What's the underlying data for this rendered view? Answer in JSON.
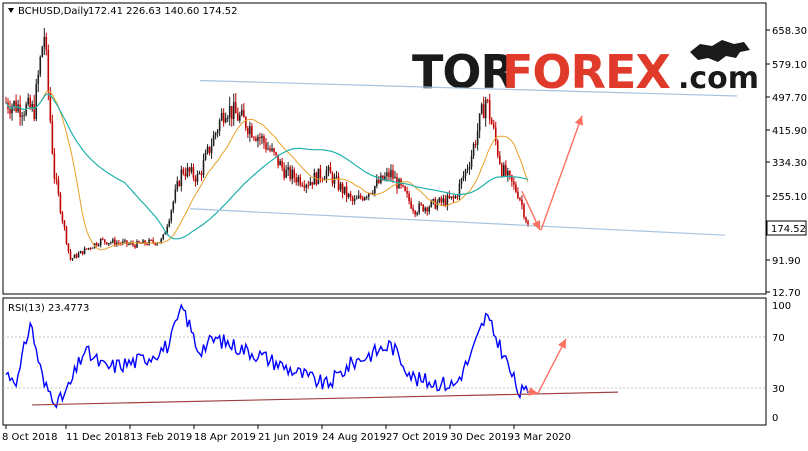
{
  "chart_data": [
    {
      "type": "candlestick",
      "panel": "price",
      "header": {
        "symbol": "BCHUSD,Daily",
        "ohlc": "172.41 226.63 140.60 174.52"
      },
      "y_ticks": [
        "658.30",
        "579.10",
        "497.70",
        "415.90",
        "334.30",
        "255.10",
        "174.52",
        "91.90",
        "12.70"
      ],
      "ylim": [
        12.7,
        695
      ],
      "last_price": "174.52",
      "x_ticks": [
        "8 Oct 2018",
        "11 Dec 2018",
        "13 Feb 2019",
        "18 Apr 2019",
        "21 Jun 2019",
        "24 Aug 2019",
        "27 Oct 2019",
        "30 Dec 2019",
        "3 Mar 2020"
      ],
      "close_path": {
        "x": [
          "8 Oct 2018",
          "5 Nov 2018",
          "15 Nov 2018",
          "25 Nov 2018",
          "11 Dec 2018",
          "10 Jan 2019",
          "13 Feb 2019",
          "13 Mar 2019",
          "2 Apr 2019",
          "18 Apr 2019",
          "15 May 2019",
          "5 Jun 2019",
          "21 Jun 2019",
          "15 Jul 2019",
          "5 Aug 2019",
          "24 Aug 2019",
          "20 Sep 2019",
          "27 Oct 2019",
          "20 Nov 2019",
          "30 Dec 2019",
          "15 Jan 2020",
          "30 Jan 2020",
          "15 Feb 2020",
          "3 Mar 2020",
          "12 Mar 2020"
        ],
        "y": [
          470,
          450,
          640,
          300,
          95,
          140,
          130,
          140,
          310,
          290,
          460,
          420,
          380,
          300,
          280,
          305,
          230,
          300,
          215,
          240,
          340,
          480,
          310,
          250,
          174.52
        ]
      },
      "ma_fast_color": "#e8a028",
      "ma_slow_color": "#20b2aa",
      "bull_color": "#1e1e1e",
      "bear_color": "#c00000",
      "trendline_color": "#a8c4e0",
      "arrow_color": "#ff7060"
    },
    {
      "type": "line",
      "panel": "indicator",
      "header": "RSI(13) 23.4773",
      "y_ticks": [
        "100",
        "70",
        "30",
        "0"
      ],
      "ylim": [
        0,
        100
      ],
      "series_color": "#0000ff",
      "trendline_color": "#a04040",
      "rsi_path": {
        "x": [
          "8 Oct 2018",
          "20 Oct 2018",
          "1 Nov 2018",
          "15 Nov 2018",
          "30 Nov 2018",
          "11 Dec 2018",
          "25 Dec 2018",
          "15 Jan 2019",
          "13 Feb 2019",
          "1 Mar 2019",
          "20 Mar 2019",
          "2 Apr 2019",
          "18 Apr 2019",
          "5 May 2019",
          "21 Jun 2019",
          "15 Jul 2019",
          "24 Aug 2019",
          "20 Sep 2019",
          "27 Oct 2019",
          "20 Nov 2019",
          "30 Dec 2019",
          "15 Jan 2020",
          "30 Jan 2020",
          "15 Feb 2020",
          "3 Mar 2020"
        ],
        "y": [
          40,
          35,
          85,
          30,
          15,
          30,
          60,
          45,
          50,
          55,
          65,
          98,
          60,
          70,
          55,
          45,
          30,
          50,
          65,
          35,
          30,
          55,
          90,
          60,
          23.4773
        ]
      }
    }
  ],
  "logo": {
    "part1": "TOR",
    "part2": "FOREX",
    "part3": ".com"
  }
}
